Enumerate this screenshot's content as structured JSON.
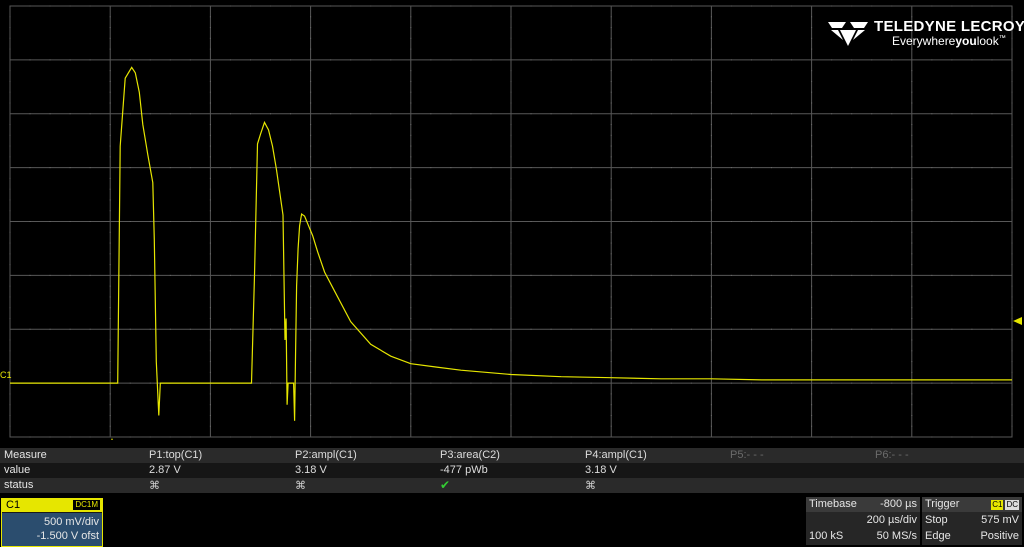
{
  "logo": {
    "brand": "TELEDYNE LECROY",
    "tagline_pre": "Everywhere",
    "tagline_bold": "you",
    "tagline_post": "look",
    "tm": "™"
  },
  "trace_label": "C1",
  "colors": {
    "trace": "#e6e600",
    "grid": "#585858",
    "background": "#000000",
    "ok": "#33cc33",
    "selected": "#2b4d6e"
  },
  "measure": {
    "row_labels": [
      "Measure",
      "value",
      "status"
    ],
    "params": [
      {
        "name": "P1:top(C1)",
        "value": "2.87 V",
        "status": "⌘"
      },
      {
        "name": "P2:ampl(C1)",
        "value": "3.18 V",
        "status": "⌘"
      },
      {
        "name": "P3:area(C2)",
        "value": "-477 pWb",
        "status": "✔"
      },
      {
        "name": "P4:ampl(C1)",
        "value": "3.18 V",
        "status": "⌘"
      },
      {
        "name": "P5:- - -",
        "value": "",
        "status": ""
      },
      {
        "name": "P6:- - -",
        "value": "",
        "status": ""
      }
    ]
  },
  "channel": {
    "name": "C1",
    "coupling": "DC1M",
    "vdiv": "500 mV/div",
    "offset": "-1.500 V ofst"
  },
  "timebase": {
    "label": "Timebase",
    "delay": "-800 µs",
    "tdiv": "200 µs/div",
    "samples": "100 kS",
    "rate": "50 MS/s"
  },
  "trigger": {
    "label": "Trigger",
    "src": "C1",
    "coupling": "DC",
    "mode": "Stop",
    "level": "575 mV",
    "type": "Edge",
    "slope": "Positive"
  },
  "chart_data": {
    "type": "line",
    "title": "",
    "xlabel": "",
    "ylabel": "",
    "x_divisions": 10,
    "y_divisions": 8,
    "time_per_div_us": 200,
    "volts_per_div": 0.5,
    "offset_v": -1.5,
    "grid": true,
    "series": [
      {
        "color": "#e6e600",
        "x": [
          -1000,
          -785,
          -780,
          -770,
          -757,
          -750,
          -742,
          -735,
          -725,
          -715,
          -712,
          -708,
          -703,
          -700,
          -600,
          -518,
          -512,
          -506,
          -500,
          -492,
          -484,
          -476,
          -468,
          -455,
          -451,
          -449,
          -447,
          -445,
          -434,
          -432,
          -430,
          -428,
          -425,
          -422,
          -418,
          -412,
          -405,
          -396,
          -386,
          -372,
          -355,
          -320,
          -280,
          -240,
          -200,
          -150,
          -100,
          0,
          100,
          200,
          300,
          400,
          500,
          600,
          700,
          800,
          900,
          1000
        ],
        "y": [
          0,
          0,
          2.2,
          2.83,
          2.93,
          2.88,
          2.7,
          2.4,
          2.12,
          1.86,
          1.33,
          0.2,
          -0.3,
          0,
          0,
          0,
          1.0,
          2.22,
          2.31,
          2.42,
          2.35,
          2.2,
          1.98,
          1.56,
          0.4,
          0.6,
          -0.2,
          0,
          0,
          -0.35,
          0.3,
          0.9,
          1.25,
          1.46,
          1.57,
          1.55,
          1.47,
          1.37,
          1.22,
          1.03,
          0.88,
          0.57,
          0.36,
          0.25,
          0.18,
          0.15,
          0.12,
          0.08,
          0.06,
          0.05,
          0.04,
          0.04,
          0.03,
          0.03,
          0.03,
          0.03,
          0.03,
          0.03
        ]
      }
    ]
  }
}
